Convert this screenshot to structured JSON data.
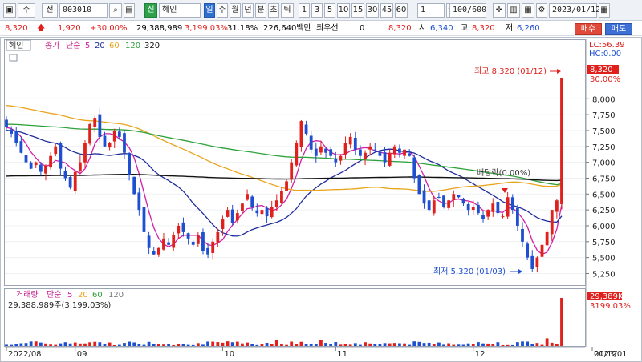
{
  "toolbar": {
    "mode_label": "주",
    "type_label": "전",
    "code": "003010",
    "shin_badge": "신",
    "stock_name": "혜인",
    "periods": [
      "일",
      "주",
      "월",
      "년",
      "분",
      "초",
      "틱"
    ],
    "selected_period": "일",
    "intervals": [
      "1",
      "3",
      "5",
      "10",
      "15",
      "30",
      "45",
      "60"
    ],
    "interval_value": "1",
    "count": "100/600",
    "date": "2023/01/12"
  },
  "quote": {
    "price": "8,320",
    "change": "1,920",
    "change_pct": "+30.00%",
    "volume": "29,388,989",
    "volume_pct": "3,199.03%",
    "turnover_pct": "31.18%",
    "amount": "226,640백만",
    "pref_label": "최우선",
    "pref_value": "0",
    "current": "8,320",
    "open_label": "시",
    "open": "6,340",
    "high_label": "고",
    "high": "8,320",
    "low_label": "저",
    "low": "6,260",
    "buy_label": "매수",
    "sell_label": "매도"
  },
  "legend": {
    "stock_tag": "혜인",
    "ma_prefix": "종가",
    "ma_type": "단순",
    "ma_periods": [
      "5",
      "20",
      "60",
      "120",
      "320"
    ],
    "ma_colors": [
      "#d21ea6",
      "#1f2c9c",
      "#e8a41c",
      "#2fa13a",
      "#111111"
    ]
  },
  "right_info": {
    "lc": "LC:56.39",
    "hc": "HC:0.00",
    "price_tag": "8,320",
    "pct_tag": "30.00%",
    "vol_tag": "29,389K",
    "vol_pct_tag": "3199.03%"
  },
  "annotations": {
    "high": "최고 8,320 (01/12)",
    "low": "최저 5,320 (01/03)",
    "dividend": "배당락(0.00%)"
  },
  "volume_legend": {
    "title": "거래량",
    "ma_type": "단순",
    "ma_periods": [
      "5",
      "20",
      "60",
      "120"
    ],
    "ma_colors": [
      "#d21ea6",
      "#e8a41c",
      "#2fa13a",
      "#777777"
    ],
    "info": "29,388,989주(3,199.03%)"
  },
  "chart_data": {
    "type": "candlestick",
    "y_ticks": [
      "8,000",
      "7,750",
      "7,500",
      "7,250",
      "7,000",
      "6,750",
      "6,500",
      "6,250",
      "6,000",
      "5,750",
      "5,500",
      "5,250"
    ],
    "y_tick_values": [
      8000,
      7750,
      7500,
      7250,
      7000,
      6750,
      6500,
      6250,
      6000,
      5750,
      5500,
      5250
    ],
    "ylim": [
      5130,
      8470
    ],
    "x_labels": [
      "2022/08",
      "09",
      "10",
      "11",
      "12",
      "2023/01",
      "01/12"
    ],
    "x_label_index": [
      0,
      14,
      44,
      67,
      95,
      125,
      140
    ],
    "candles_closes": [
      7550,
      7450,
      7300,
      7150,
      7000,
      6900,
      7000,
      6850,
      6950,
      7100,
      7250,
      6900,
      6750,
      6600,
      6850,
      7000,
      7300,
      7600,
      7700,
      7400,
      7250,
      7300,
      7500,
      7400,
      7150,
      6800,
      6500,
      6250,
      5900,
      5650,
      5550,
      5650,
      5800,
      5700,
      5850,
      6000,
      5900,
      5800,
      5700,
      5850,
      5600,
      5550,
      5750,
      5900,
      6100,
      6250,
      6050,
      6200,
      6350,
      6500,
      6300,
      6200,
      6250,
      6150,
      6300,
      6400,
      6550,
      6700,
      7000,
      7300,
      7650,
      7450,
      7200,
      7100,
      7250,
      7150,
      7100,
      7000,
      7100,
      7300,
      7400,
      7200,
      7100,
      7150,
      7250,
      7200,
      7100,
      7000,
      7150,
      7250,
      7150,
      7200,
      7100,
      6750,
      6500,
      6350,
      6250,
      6400,
      6450,
      6300,
      6400,
      6500,
      6450,
      6350,
      6250,
      6300,
      6200,
      6100,
      6250,
      6350,
      6200,
      6150,
      6450,
      6250,
      6000,
      5750,
      5500,
      5320,
      5500,
      5700,
      5900,
      6250,
      6400,
      8320
    ],
    "ma_lines": [
      "MA5",
      "MA20",
      "MA60",
      "MA120",
      "MA320"
    ]
  }
}
